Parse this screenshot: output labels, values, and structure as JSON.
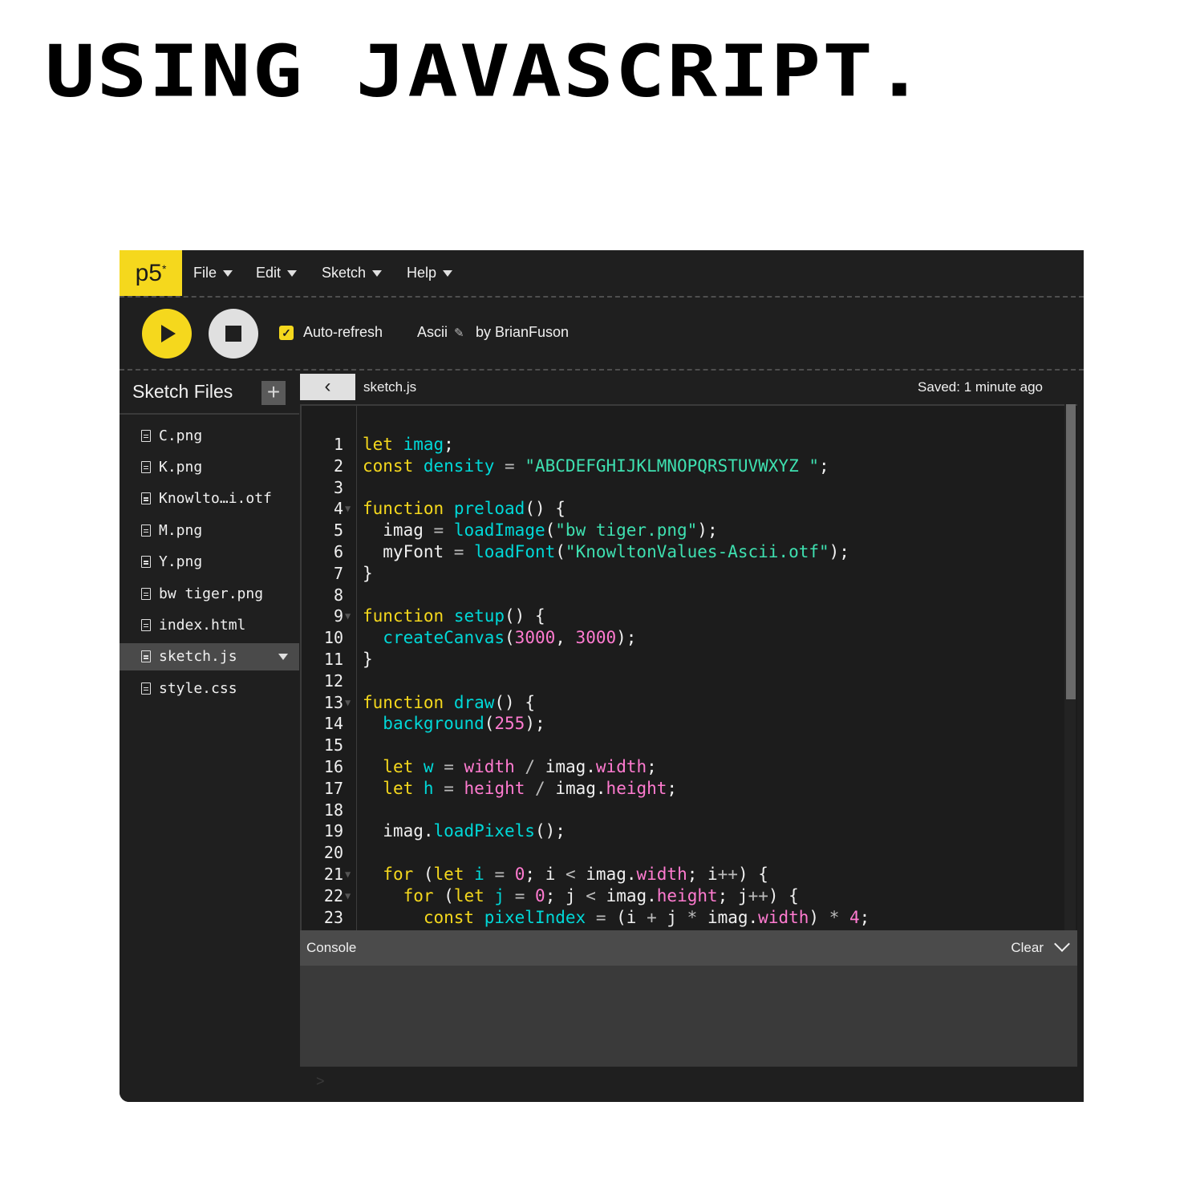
{
  "headline": "USING JAVASCRIPT.",
  "app": {
    "logo": "p5",
    "logo_mark": "*",
    "menu": [
      "File",
      "Edit",
      "Sketch",
      "Help"
    ]
  },
  "toolbar": {
    "auto_refresh_label": "Auto-refresh",
    "auto_refresh_checked": true,
    "sketch_name": "Ascii",
    "author": "by BrianFuson"
  },
  "sidebar": {
    "title": "Sketch Files",
    "add_label": "+",
    "files": [
      {
        "name": "C.png",
        "active": false
      },
      {
        "name": "K.png",
        "active": false
      },
      {
        "name": "Knowlto…i.otf",
        "active": false
      },
      {
        "name": "M.png",
        "active": false
      },
      {
        "name": "Y.png",
        "active": false
      },
      {
        "name": "bw tiger.png",
        "active": false
      },
      {
        "name": "index.html",
        "active": false
      },
      {
        "name": "sketch.js",
        "active": true
      },
      {
        "name": "style.css",
        "active": false
      }
    ]
  },
  "editor": {
    "tab": "sketch.js",
    "saved_status": "Saved: 1 minute ago",
    "foldable_lines": [
      4,
      9,
      13,
      21,
      22
    ],
    "lines": [
      [
        [
          "kw",
          "let"
        ],
        [
          "t",
          " "
        ],
        [
          "vr",
          "imag"
        ],
        [
          "t",
          ";"
        ]
      ],
      [
        [
          "kw",
          "const"
        ],
        [
          "t",
          " "
        ],
        [
          "vr",
          "density"
        ],
        [
          "t",
          " "
        ],
        [
          "op",
          "="
        ],
        [
          "t",
          " "
        ],
        [
          "st",
          "\"ABCDEFGHIJKLMNOPQRSTUVWXYZ \""
        ],
        [
          "t",
          ";"
        ]
      ],
      [],
      [
        [
          "kw",
          "function"
        ],
        [
          "t",
          " "
        ],
        [
          "fn",
          "preload"
        ],
        [
          "t",
          "() {"
        ]
      ],
      [
        [
          "t",
          "  imag "
        ],
        [
          "op",
          "="
        ],
        [
          "t",
          " "
        ],
        [
          "fn",
          "loadImage"
        ],
        [
          "t",
          "("
        ],
        [
          "st",
          "\"bw tiger.png\""
        ],
        [
          "t",
          ");"
        ]
      ],
      [
        [
          "t",
          "  myFont "
        ],
        [
          "op",
          "="
        ],
        [
          "t",
          " "
        ],
        [
          "fn",
          "loadFont"
        ],
        [
          "t",
          "("
        ],
        [
          "st",
          "\"KnowltonValues-Ascii.otf\""
        ],
        [
          "t",
          ");"
        ]
      ],
      [
        [
          "t",
          "}"
        ]
      ],
      [],
      [
        [
          "kw",
          "function"
        ],
        [
          "t",
          " "
        ],
        [
          "fn",
          "setup"
        ],
        [
          "t",
          "() {"
        ]
      ],
      [
        [
          "t",
          "  "
        ],
        [
          "fn",
          "createCanvas"
        ],
        [
          "t",
          "("
        ],
        [
          "nm",
          "3000"
        ],
        [
          "t",
          ", "
        ],
        [
          "nm",
          "3000"
        ],
        [
          "t",
          ");"
        ]
      ],
      [
        [
          "t",
          "}"
        ]
      ],
      [],
      [
        [
          "kw",
          "function"
        ],
        [
          "t",
          " "
        ],
        [
          "fn",
          "draw"
        ],
        [
          "t",
          "() {"
        ]
      ],
      [
        [
          "t",
          "  "
        ],
        [
          "fn",
          "background"
        ],
        [
          "t",
          "("
        ],
        [
          "nm",
          "255"
        ],
        [
          "t",
          ");"
        ]
      ],
      [],
      [
        [
          "t",
          "  "
        ],
        [
          "kw",
          "let"
        ],
        [
          "t",
          " "
        ],
        [
          "vr",
          "w"
        ],
        [
          "t",
          " "
        ],
        [
          "op",
          "="
        ],
        [
          "t",
          " "
        ],
        [
          "pr",
          "width"
        ],
        [
          "t",
          " "
        ],
        [
          "op",
          "/"
        ],
        [
          "t",
          " imag."
        ],
        [
          "pr",
          "width"
        ],
        [
          "t",
          ";"
        ]
      ],
      [
        [
          "t",
          "  "
        ],
        [
          "kw",
          "let"
        ],
        [
          "t",
          " "
        ],
        [
          "vr",
          "h"
        ],
        [
          "t",
          " "
        ],
        [
          "op",
          "="
        ],
        [
          "t",
          " "
        ],
        [
          "pr",
          "height"
        ],
        [
          "t",
          " "
        ],
        [
          "op",
          "/"
        ],
        [
          "t",
          " imag."
        ],
        [
          "pr",
          "height"
        ],
        [
          "t",
          ";"
        ]
      ],
      [],
      [
        [
          "t",
          "  imag."
        ],
        [
          "fn",
          "loadPixels"
        ],
        [
          "t",
          "();"
        ]
      ],
      [],
      [
        [
          "t",
          "  "
        ],
        [
          "kw",
          "for"
        ],
        [
          "t",
          " ("
        ],
        [
          "kw",
          "let"
        ],
        [
          "t",
          " "
        ],
        [
          "vr",
          "i"
        ],
        [
          "t",
          " "
        ],
        [
          "op",
          "="
        ],
        [
          "t",
          " "
        ],
        [
          "nm",
          "0"
        ],
        [
          "t",
          "; i "
        ],
        [
          "op",
          "<"
        ],
        [
          "t",
          " imag."
        ],
        [
          "pr",
          "width"
        ],
        [
          "t",
          "; i"
        ],
        [
          "op",
          "++"
        ],
        [
          "t",
          ") {"
        ]
      ],
      [
        [
          "t",
          "    "
        ],
        [
          "kw",
          "for"
        ],
        [
          "t",
          " ("
        ],
        [
          "kw",
          "let"
        ],
        [
          "t",
          " "
        ],
        [
          "vr",
          "j"
        ],
        [
          "t",
          " "
        ],
        [
          "op",
          "="
        ],
        [
          "t",
          " "
        ],
        [
          "nm",
          "0"
        ],
        [
          "t",
          "; j "
        ],
        [
          "op",
          "<"
        ],
        [
          "t",
          " imag."
        ],
        [
          "pr",
          "height"
        ],
        [
          "t",
          "; j"
        ],
        [
          "op",
          "++"
        ],
        [
          "t",
          ") {"
        ]
      ],
      [
        [
          "t",
          "      "
        ],
        [
          "kw",
          "const"
        ],
        [
          "t",
          " "
        ],
        [
          "vr",
          "pixelIndex"
        ],
        [
          "t",
          " "
        ],
        [
          "op",
          "="
        ],
        [
          "t",
          " (i "
        ],
        [
          "op",
          "+"
        ],
        [
          "t",
          " j "
        ],
        [
          "op",
          "*"
        ],
        [
          "t",
          " imag."
        ],
        [
          "pr",
          "width"
        ],
        [
          "t",
          ") "
        ],
        [
          "op",
          "*"
        ],
        [
          "t",
          " "
        ],
        [
          "nm",
          "4"
        ],
        [
          "t",
          ";"
        ]
      ]
    ]
  },
  "console": {
    "title": "Console",
    "clear_label": "Clear",
    "prompt": ">"
  }
}
